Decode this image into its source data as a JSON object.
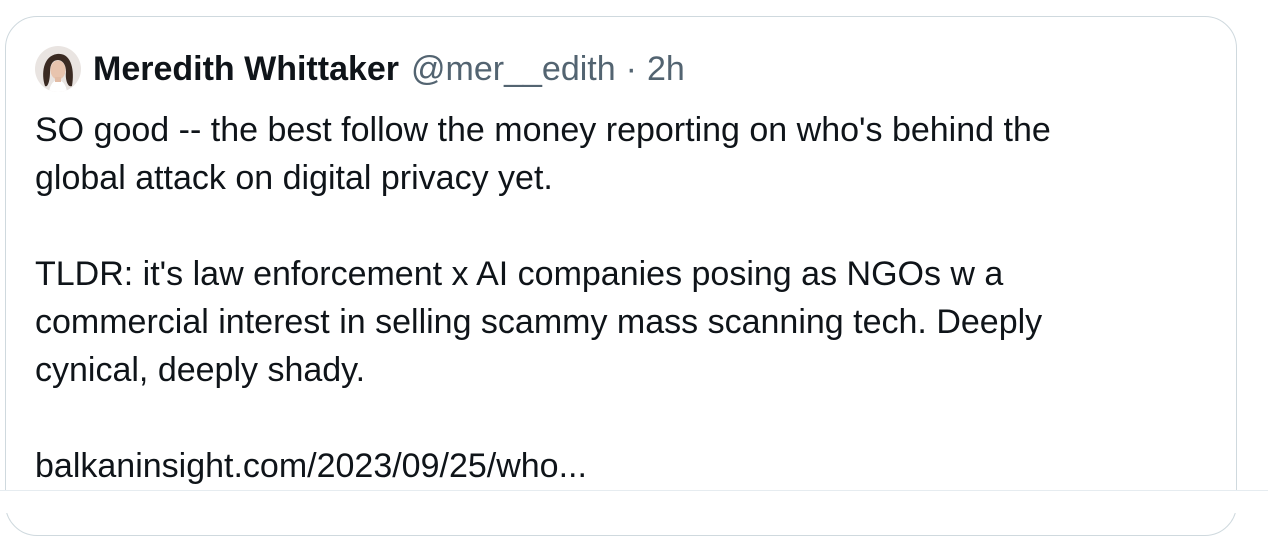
{
  "tweet": {
    "author": {
      "display_name": "Meredith Whittaker",
      "handle": "@mer__edith",
      "separator": "·",
      "time": "2h",
      "avatar_icon": "author-avatar"
    },
    "text": {
      "line1": "SO good -- the best follow the money reporting on who's behind the",
      "line2": "global attack on digital privacy yet.",
      "line3": "TLDR: it's law enforcement x AI companies posing as NGOs w a",
      "line4": "commercial interest in selling scammy mass scanning tech. Deeply",
      "line5": "cynical, deeply shady.",
      "link": "balkaninsight.com/2023/09/25/who..."
    }
  },
  "colors": {
    "text_primary": "#0f1419",
    "text_secondary": "#536471",
    "border": "#cfd9de"
  }
}
